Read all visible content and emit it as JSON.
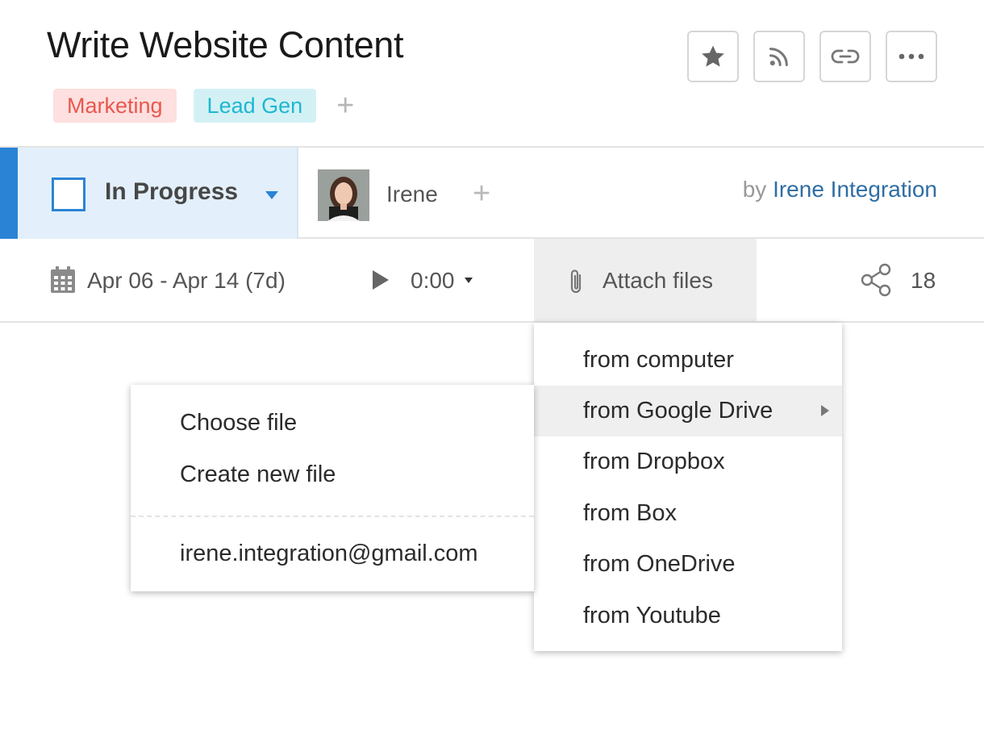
{
  "task": {
    "title": "Write Website Content",
    "tags": [
      {
        "label": "Marketing",
        "bg": "#fde0df",
        "fg": "#e8584f"
      },
      {
        "label": "Lead Gen",
        "bg": "#d3f1f5",
        "fg": "#1eb7d1"
      }
    ],
    "add_tag_glyph": "+"
  },
  "actions": [
    {
      "icon": "star-icon"
    },
    {
      "icon": "rss-icon"
    },
    {
      "icon": "link-icon"
    },
    {
      "icon": "more-icon"
    }
  ],
  "status": {
    "label": "In Progress",
    "accent_color": "#2b83d6"
  },
  "assignee": {
    "name": "Irene",
    "add_glyph": "+"
  },
  "author": {
    "prefix": "by",
    "name": "Irene Integration"
  },
  "meta": {
    "date_range": "Apr 06 - Apr 14 (7d)",
    "timer": "0:00",
    "attach_label": "Attach files",
    "share_count": "18"
  },
  "attach_menu": {
    "items": [
      "from computer",
      "from Google Drive",
      "from Dropbox",
      "from Box",
      "from OneDrive",
      "from Youtube"
    ],
    "active_index": 1
  },
  "google_drive_submenu": {
    "choose": "Choose file",
    "create": "Create new file",
    "account": "irene.integration@gmail.com"
  }
}
